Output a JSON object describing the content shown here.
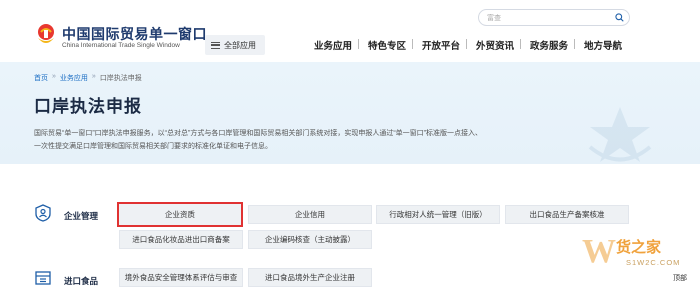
{
  "header": {
    "logo_cn": "中国国际贸易单一窗口",
    "logo_en": "China International Trade Single Window",
    "all_apps": "全部应用",
    "search_placeholder": "富查",
    "nav": [
      "业务应用",
      "特色专区",
      "开放平台",
      "外贸资讯",
      "政务服务",
      "地方导航"
    ]
  },
  "banner": {
    "breadcrumb": [
      "首页",
      "业务应用",
      "口岸执法申报"
    ],
    "title": "口岸执法申报",
    "desc_line1": "国际贸易“单一窗口”口岸执法申报服务，以“总对总”方式与各口岸管理和国际贸易相关部门系统对接，实现申报人通过“单一窗口”标准版一点接入、",
    "desc_line2": "一次性提交满足口岸管理和国际贸易相关部门要求的标准化单证和电子信息。"
  },
  "sections": [
    {
      "label": "企业管理",
      "icon": "enterprise-icon",
      "buttons": [
        "企业资质",
        "企业信用",
        "行政相对人统一管理（旧版）",
        "出口食品生产备案核准",
        "进口食品化妆品进出口商备案",
        "企业编码核查（主动披露）"
      ]
    },
    {
      "label": "进口食品",
      "icon": "food-icon",
      "buttons": [
        "境外食品安全管理体系评估与审查",
        "进口食品境外生产企业注册"
      ]
    }
  ],
  "selected_button": "企业资质",
  "brand": {
    "name": "货之家",
    "url": "S1W2C.COM"
  },
  "back_top": "顶部",
  "colors": {
    "accent": "#e03232",
    "banner_bg": "#e8f3fa",
    "button_bg": "#eef1f4"
  }
}
